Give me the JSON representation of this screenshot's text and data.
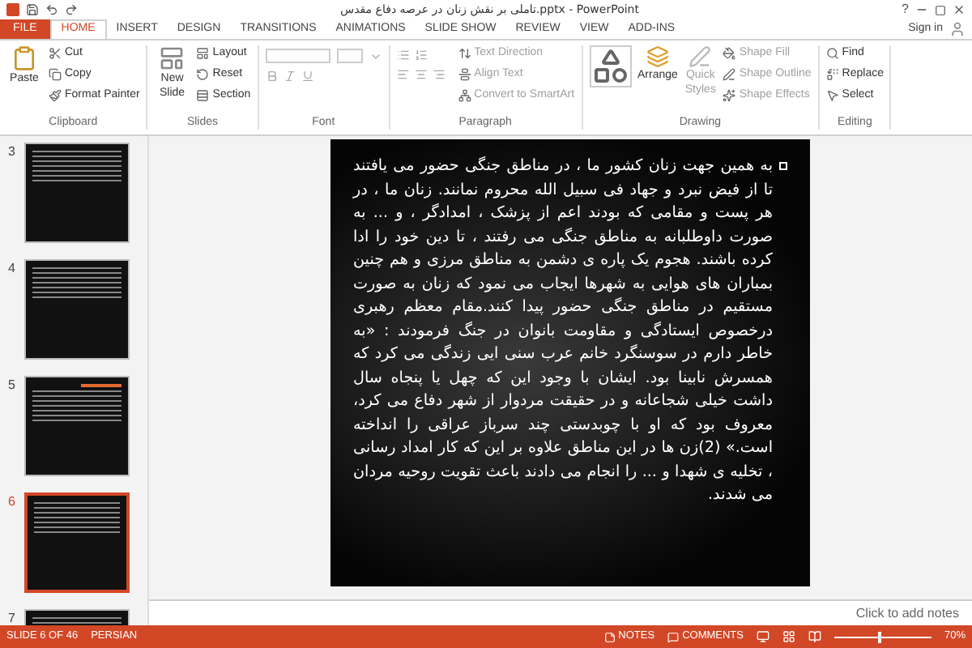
{
  "window": {
    "title": "تاملی بر نقش زنان در عرصه دفاع مقدس.pptx - PowerPoint",
    "help": "?",
    "sign_in": "Sign in"
  },
  "tabs": [
    {
      "label": "FILE",
      "selected": false,
      "kind": "file"
    },
    {
      "label": "HOME",
      "selected": true,
      "kind": "tab"
    },
    {
      "label": "INSERT",
      "selected": false,
      "kind": "tab"
    },
    {
      "label": "DESIGN",
      "selected": false,
      "kind": "tab"
    },
    {
      "label": "TRANSITIONS",
      "selected": false,
      "kind": "tab"
    },
    {
      "label": "ANIMATIONS",
      "selected": false,
      "kind": "tab"
    },
    {
      "label": "SLIDE SHOW",
      "selected": false,
      "kind": "tab"
    },
    {
      "label": "REVIEW",
      "selected": false,
      "kind": "tab"
    },
    {
      "label": "VIEW",
      "selected": false,
      "kind": "tab"
    },
    {
      "label": "ADD-INS",
      "selected": false,
      "kind": "tab"
    }
  ],
  "ribbon": [
    {
      "label": "Clipboard",
      "kind": "clipboard",
      "large": "Paste",
      "small": [
        "Cut",
        "Copy",
        "Format Painter"
      ]
    },
    {
      "label": "Slides",
      "kind": "slides",
      "large": "New Slide",
      "small": [
        "Layout",
        "Reset",
        "Section"
      ]
    },
    {
      "label": "Font",
      "kind": "font"
    },
    {
      "label": "Paragraph",
      "kind": "paragraph",
      "small": [
        "Text Direction",
        "Align Text",
        "Convert to SmartArt"
      ]
    },
    {
      "label": "Drawing",
      "kind": "drawing",
      "large": "Arrange",
      "large2": "Quick Styles",
      "small": [
        "Shape Fill",
        "Shape Outline",
        "Shape Effects"
      ]
    },
    {
      "label": "Editing",
      "kind": "editing",
      "small": [
        "Find",
        "Replace",
        "Select"
      ]
    }
  ],
  "thumbnails": [
    {
      "number": "3",
      "selected": false,
      "kind": "text"
    },
    {
      "number": "4",
      "selected": false,
      "kind": "text"
    },
    {
      "number": "5",
      "selected": false,
      "kind": "titled"
    },
    {
      "number": "6",
      "selected": true,
      "kind": "text"
    },
    {
      "number": "7",
      "selected": false,
      "kind": "text"
    }
  ],
  "slide": {
    "body": "به همین جهت زنان کشور ما ، در مناطق جنگی حضور می یافتند تا از فیض نبرد و جهاد فی سبیل الله محروم نمانند. زنان ما ، در هر پست و مقامی که بودند اعم از پزشک ، امدادگر ، و ... به صورت داوطلبانه به مناطق جنگی می رفتند ، تا دین خود را ادا کرده باشند. هجوم یک پاره ی دشمن به مناطق مرزی و هم چنین بمباران های هوایی به شهرها ایجاب می نمود که زنان به صورت مستقیم در مناطق جنگی حضور پیدا کنند.مقام معظم رهبری درخصوص ایستادگی و مقاومت بانوان در جنگ فرمودند : «به خاطر دارم در سوسنگرد خانم عرب سنی ایی زندگی می کرد که همسرش نابینا بود. ایشان با وجود این که چهل یا پنجاه سال داشت خیلی شجاعانه و در حقیقت مردوار از شهر دفاع می کرد، معروف بود که او با چوبدستی چند سرباز عراقی را انداخته است.» (2)زن ها در این مناطق علاوه بر این که کار امداد رسانی ، تخلیه ی شهدا و ... را انجام می دادند باعث تقویت روحیه مردان می شدند."
  },
  "notes": {
    "placeholder": "Click to add notes"
  },
  "status_bar": {
    "slide": "SLIDE 6 OF 46",
    "language": "PERSIAN",
    "notes": "NOTES",
    "comments": "COMMENTS",
    "zoom": "70%",
    "level": 0.45
  }
}
